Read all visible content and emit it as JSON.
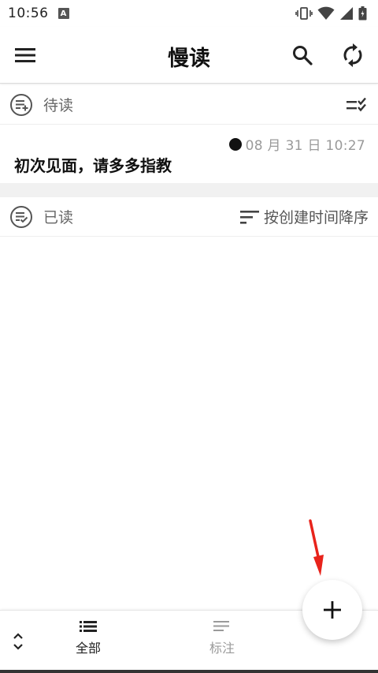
{
  "status_bar": {
    "time": "10:56",
    "notification_icon": "A"
  },
  "app_bar": {
    "title": "慢读"
  },
  "unread_section": {
    "title": "待读"
  },
  "unread_items": [
    {
      "date": "08 月 31 日 10:27",
      "title": "初次见面，请多多指教"
    }
  ],
  "read_section": {
    "title": "已读",
    "sort_label": "按创建时间降序"
  },
  "bottom_nav": {
    "tabs": [
      {
        "label": "全部",
        "icon": "list-icon",
        "active": true
      },
      {
        "label": "标注",
        "icon": "notes-icon",
        "active": false
      }
    ]
  },
  "colors": {
    "accent_arrow": "#e8231b",
    "muted_text": "#9a9a9a"
  }
}
